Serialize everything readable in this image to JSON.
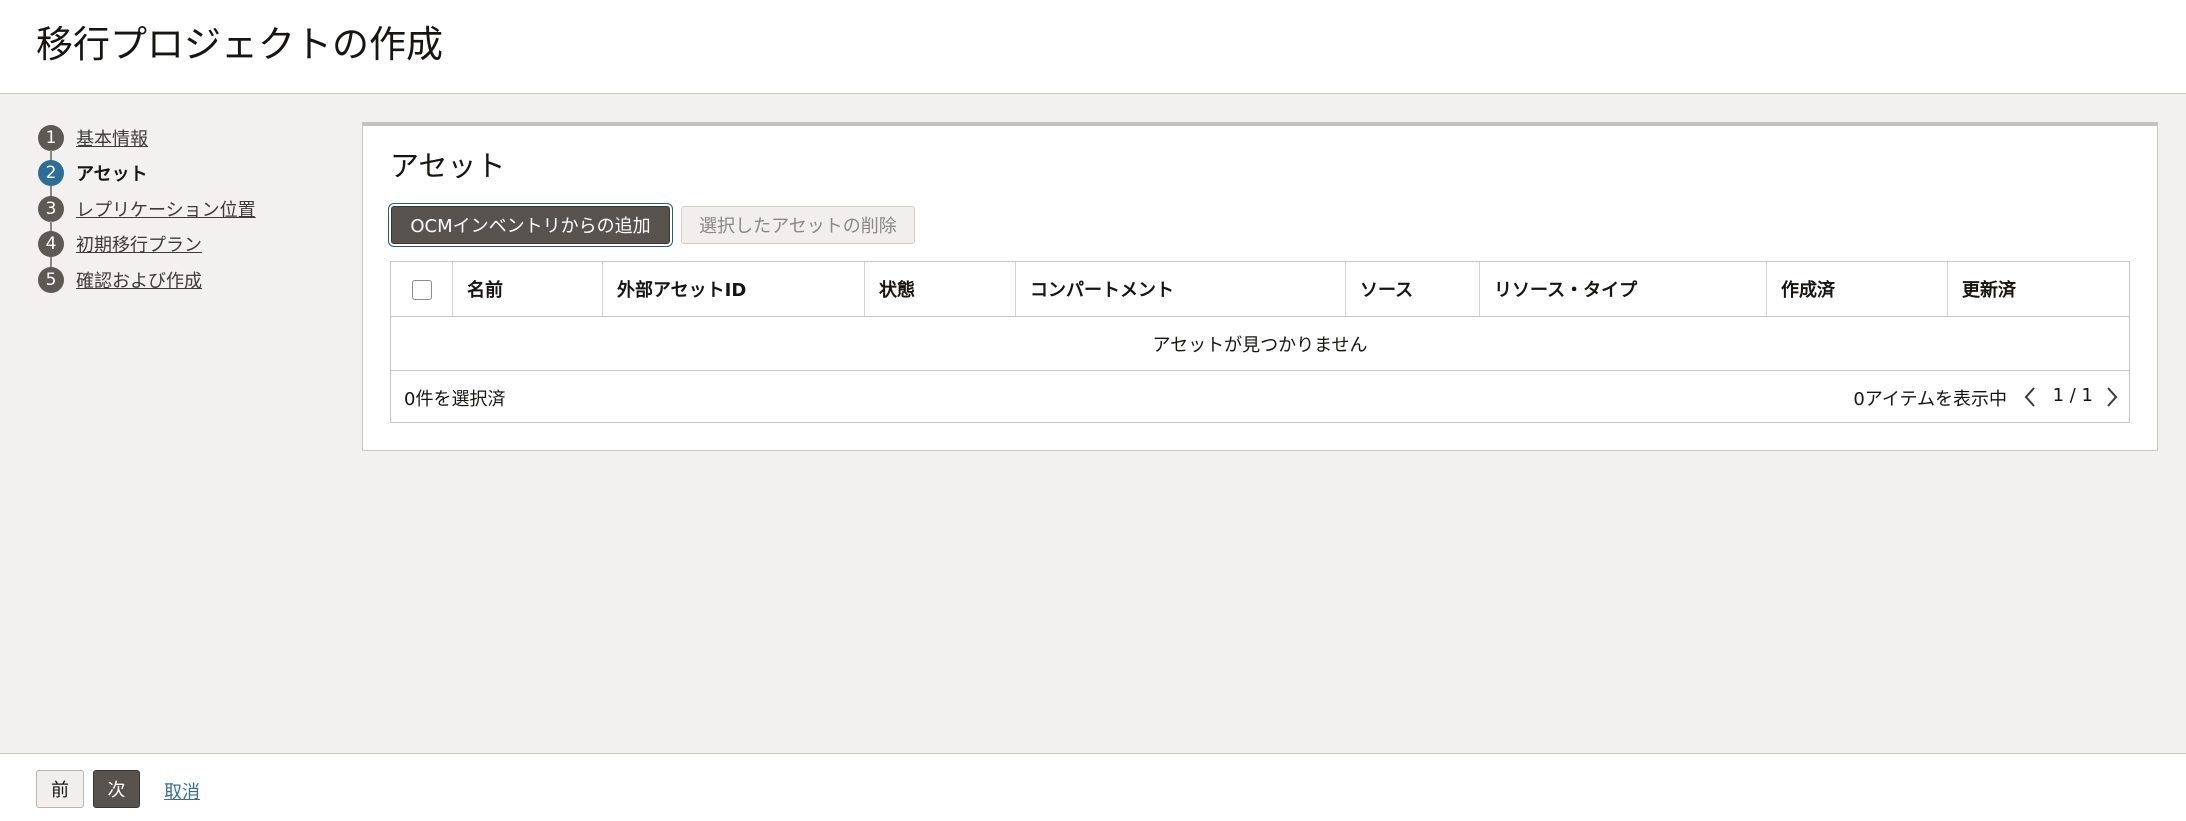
{
  "header": {
    "title": "移行プロジェクトの作成"
  },
  "steps": [
    {
      "num": "1",
      "label": "基本情報",
      "current": false
    },
    {
      "num": "2",
      "label": "アセット",
      "current": true
    },
    {
      "num": "3",
      "label": "レプリケーション位置",
      "current": false
    },
    {
      "num": "4",
      "label": "初期移行プラン",
      "current": false
    },
    {
      "num": "5",
      "label": "確認および作成",
      "current": false
    }
  ],
  "card": {
    "title": "アセット",
    "add_button": "OCMインベントリからの追加",
    "delete_button": "選択したアセットの削除"
  },
  "table": {
    "columns": [
      "名前",
      "外部アセットID",
      "状態",
      "コンパートメント",
      "ソース",
      "リソース・タイプ",
      "作成済",
      "更新済"
    ],
    "empty_message": "アセットが見つかりません",
    "selected_count": "0件を選択済",
    "items_shown": "0アイテムを表示中",
    "page": "1 / 1"
  },
  "footer": {
    "prev_label": "前",
    "next_label": "次",
    "cancel_label": "取消"
  },
  "colors": {
    "accent": "#2c6e96",
    "primary_button": "#58534f",
    "link": "#3b6e8f"
  }
}
